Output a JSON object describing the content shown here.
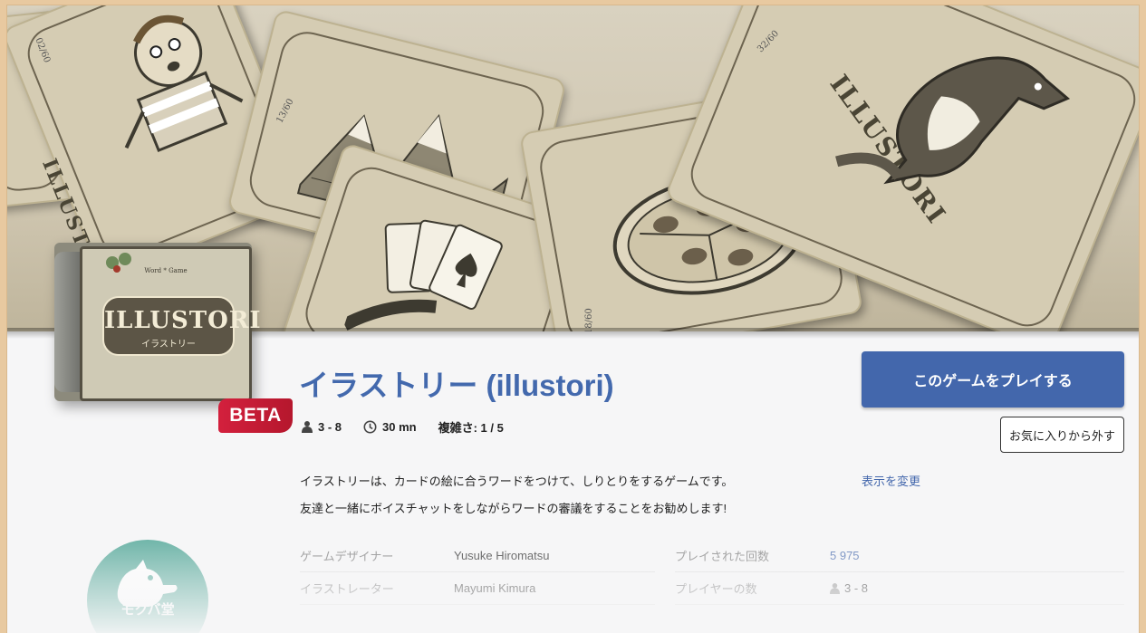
{
  "game": {
    "title": "イラストリー (illustori)",
    "badge": "BETA",
    "players": "3 - 8",
    "duration": "30 mn",
    "complexity": "複雑さ: 1 / 5"
  },
  "banner": {
    "card_logo": "ILLUSTORI",
    "card_numbers": [
      "02/60",
      "13/60",
      "18/60",
      "32/60"
    ],
    "box_title": "ILLUSTORI",
    "box_subtitle": "イラストリー",
    "box_tagline": "Word * Game"
  },
  "actions": {
    "play_label": "このゲームをプレイする",
    "favorite_label": "お気に入りから外す",
    "change_view_label": "表示を変更"
  },
  "description": {
    "line1": "イラストリーは、カードの絵に合うワードをつけて、しりとりをするゲームです。",
    "line2": "友達と一緒にボイスチャットをしながらワードの審議をすることをお勧めします!"
  },
  "details_left": [
    {
      "label": "ゲームデザイナー",
      "value": "Yusuke Hiromatsu"
    },
    {
      "label": "イラストレーター",
      "value": "Mayumi Kimura"
    }
  ],
  "details_right": [
    {
      "label": "プレイされた回数",
      "value": "5 975"
    },
    {
      "label": "プレイヤーの数",
      "value": "3 - 8"
    }
  ],
  "publisher": {
    "name": "モクバ堂"
  },
  "colors": {
    "accent": "#4367ac",
    "beta": "#c81b34",
    "publisher": "#4aa393"
  }
}
